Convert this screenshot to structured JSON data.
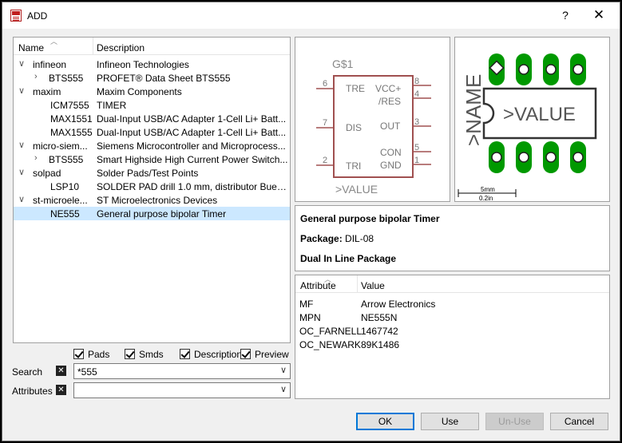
{
  "window": {
    "title": "ADD",
    "help": "?",
    "close": "✕"
  },
  "tree": {
    "columns": {
      "name": "Name",
      "description": "Description"
    },
    "rows": [
      {
        "arrow": "∨",
        "name": "infineon",
        "desc": "Infineon Technologies",
        "indent": 0
      },
      {
        "arrow": "›",
        "name": "BTS555",
        "desc": "PROFET® Data Sheet BTS555",
        "indent": 1
      },
      {
        "arrow": "∨",
        "name": "maxim",
        "desc": "Maxim Components",
        "indent": 0
      },
      {
        "arrow": "",
        "name": "ICM7555",
        "desc": "TIMER",
        "indent": 2
      },
      {
        "arrow": "",
        "name": "MAX1551",
        "desc": "Dual-Input USB/AC Adapter 1-Cell Li+ Batt...",
        "indent": 2
      },
      {
        "arrow": "",
        "name": "MAX1555",
        "desc": "Dual-Input USB/AC Adapter 1-Cell Li+ Batt...",
        "indent": 2
      },
      {
        "arrow": "∨",
        "name": "micro-siem...",
        "desc": "Siemens Microcontroller and Microprocess...",
        "indent": 0
      },
      {
        "arrow": "›",
        "name": "BTS555",
        "desc": "Smart Highside High Current Power Switch...",
        "indent": 1
      },
      {
        "arrow": "∨",
        "name": "solpad",
        "desc": "Solder Pads/Test Points",
        "indent": 0
      },
      {
        "arrow": "",
        "name": "LSP10",
        "desc": "SOLDER PAD drill 1.0 mm, distributor Buerk...",
        "indent": 2
      },
      {
        "arrow": "∨",
        "name": "st-microele...",
        "desc": "ST Microelectronics Devices",
        "indent": 0
      },
      {
        "arrow": "",
        "name": "NE555",
        "desc": "General purpose bipolar Timer",
        "indent": 2,
        "selected": true
      }
    ]
  },
  "filters": {
    "pads": "Pads",
    "smds": "Smds",
    "description": "Description",
    "preview": "Preview"
  },
  "search": {
    "label": "Search",
    "value": "*555",
    "clear": "✕"
  },
  "attributes_field": {
    "label": "Attributes",
    "value": "",
    "clear": "✕"
  },
  "symbol": {
    "name": "G$1",
    "value": ">VALUE",
    "pins_left": [
      {
        "num": "6",
        "label": "TRE"
      },
      {
        "num": "7",
        "label": "DIS"
      },
      {
        "num": "2",
        "label": "TRI"
      }
    ],
    "pins_right": [
      {
        "num": "8",
        "label": "VCC+"
      },
      {
        "num": "4",
        "label": "/RES"
      },
      {
        "num": "3",
        "label": "OUT"
      },
      {
        "num": "5",
        "label": "CON"
      },
      {
        "num": "1",
        "label": "GND"
      }
    ]
  },
  "package": {
    "name_text": ">NAME",
    "value_text": ">VALUE",
    "scale_mm": "5mm",
    "scale_in": "0.2in",
    "pad_color": "#009900"
  },
  "info": {
    "title": "General purpose bipolar Timer",
    "package_label": "Package:",
    "package_value": "DIL-08",
    "description": "Dual In Line Package"
  },
  "attributes_table": {
    "columns": {
      "attribute": "Attribute",
      "value": "Value"
    },
    "rows": [
      {
        "k": "MF",
        "v": "Arrow Electronics"
      },
      {
        "k": "MPN",
        "v": "NE555N"
      },
      {
        "k": "OC_FARNELL",
        "v": "1467742"
      },
      {
        "k": "OC_NEWARK",
        "v": "89K1486"
      }
    ]
  },
  "buttons": {
    "ok": "OK",
    "use": "Use",
    "unuse": "Un-Use",
    "cancel": "Cancel"
  }
}
